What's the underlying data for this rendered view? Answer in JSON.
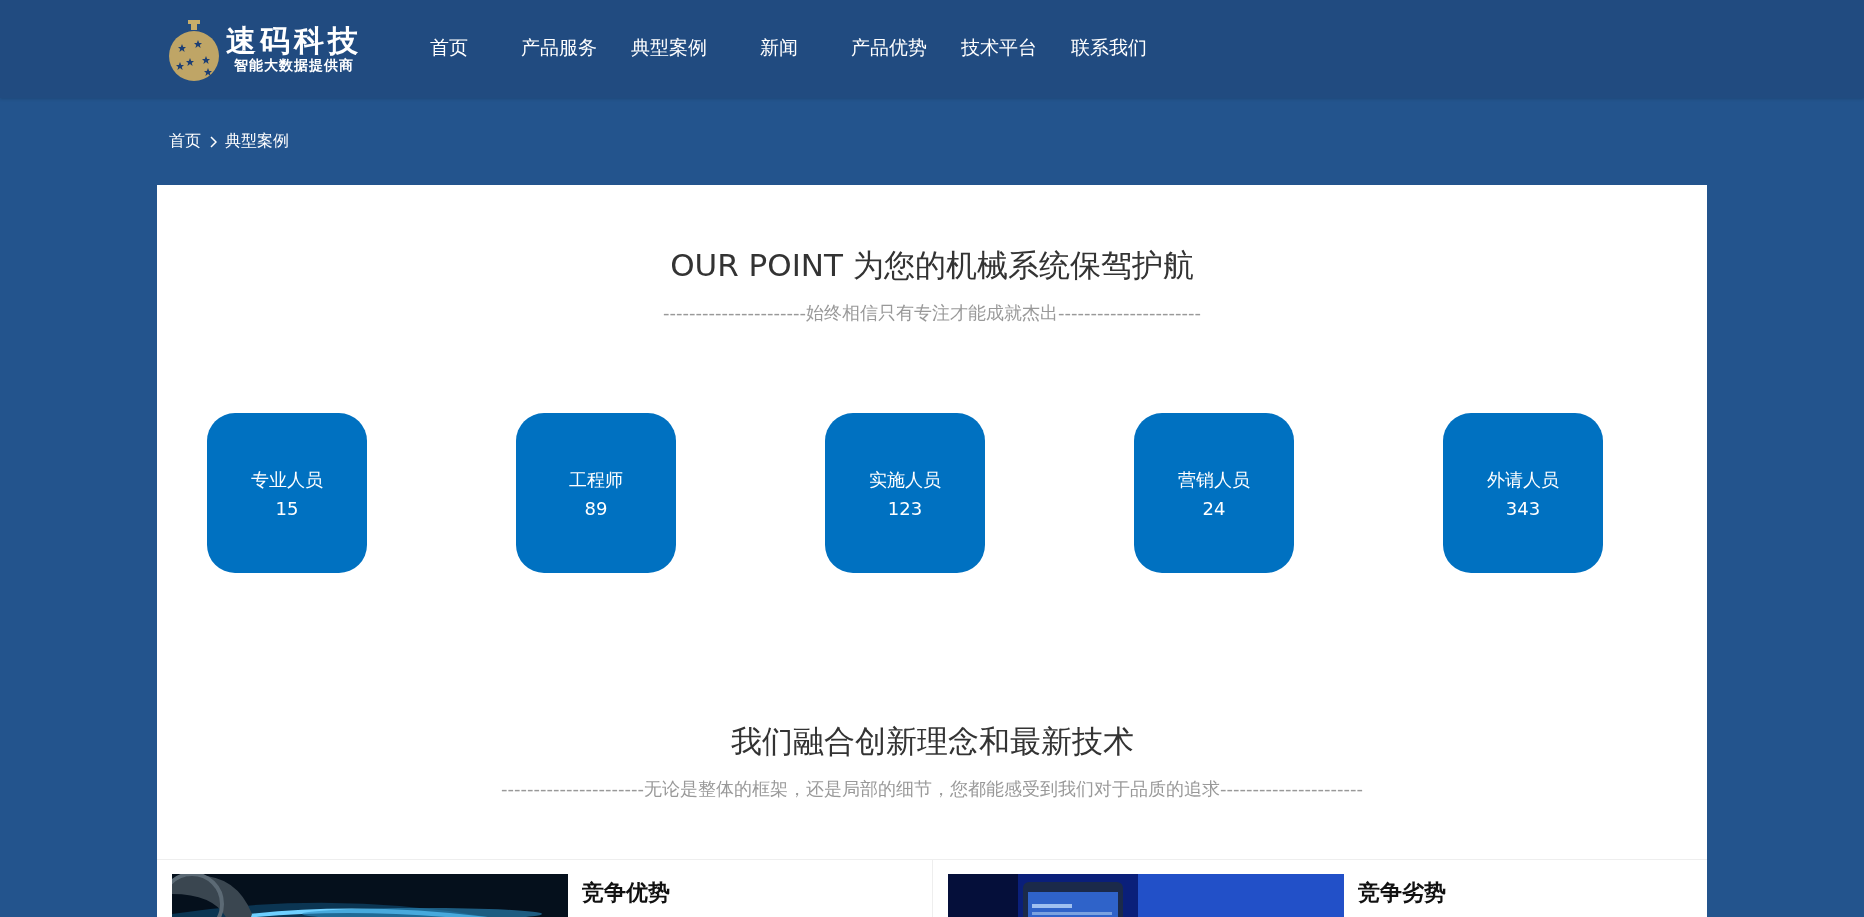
{
  "logo": {
    "title": "速码科技",
    "tagline": "智能大数据提供商"
  },
  "nav": [
    {
      "label": "首页",
      "selected": false
    },
    {
      "label": "产品服务",
      "selected": false
    },
    {
      "label": "典型案例",
      "selected": false
    },
    {
      "label": "新闻",
      "selected": false
    },
    {
      "label": "产品优势",
      "selected": false
    },
    {
      "label": "技术平台",
      "selected": false
    },
    {
      "label": "联系我们",
      "selected": false
    }
  ],
  "breadcrumb": [
    "首页",
    "典型案例"
  ],
  "point_section": {
    "title": "OUR POINT 为您的机械系统保驾护航",
    "subtitle": "----------------------始终相信只有专注才能成就杰出----------------------"
  },
  "stats": [
    {
      "label": "专业人员",
      "value": "15"
    },
    {
      "label": "工程师",
      "value": "89"
    },
    {
      "label": "实施人员",
      "value": "123"
    },
    {
      "label": "营销人员",
      "value": "24"
    },
    {
      "label": "外请人员",
      "value": "343"
    }
  ],
  "tech_section": {
    "title": "我们融合创新理念和最新技术",
    "subtitle": "----------------------无论是整体的框架，还是局部的细节，您都能感受到我们对于品质的追求----------------------"
  },
  "cards": [
    {
      "kind": "streak",
      "title": "竞争优势"
    },
    {
      "kind": "phone",
      "title": "竞争劣势"
    }
  ]
}
